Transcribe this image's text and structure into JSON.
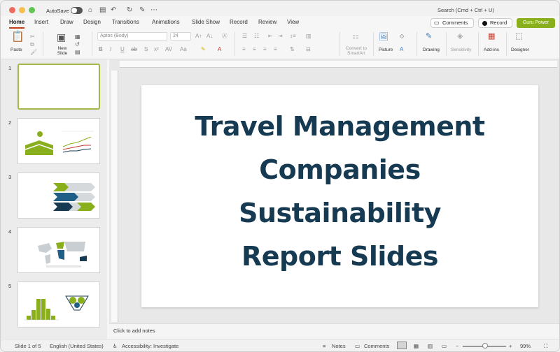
{
  "titlebar": {
    "autosave_label": "AutoSave",
    "search_placeholder": "Search (Cmd + Ctrl + U)"
  },
  "ribbon_tabs": [
    "Home",
    "Insert",
    "Draw",
    "Design",
    "Transitions",
    "Animations",
    "Slide Show",
    "Record",
    "Review",
    "View"
  ],
  "ribbon_buttons": {
    "comments": "Comments",
    "record": "Record",
    "guru_power": "Guru Power"
  },
  "ribbon": {
    "paste": "Paste",
    "new_slide": "New Slide",
    "font_name": "Aptos (Body)",
    "font_size": "24",
    "convert_smartart": "Convert to SmartArt",
    "picture": "Picture",
    "drawing": "Drawing",
    "sensitivity": "Sensitivity",
    "addins": "Add-ins",
    "designer": "Designer"
  },
  "thumbnails": [
    {
      "number": "1"
    },
    {
      "number": "2"
    },
    {
      "number": "3"
    },
    {
      "number": "4"
    },
    {
      "number": "5"
    }
  ],
  "slide": {
    "title_lines": [
      "Travel Management",
      "Companies",
      "Sustainability",
      "Report Slides"
    ],
    "title_color": "#163a52"
  },
  "notes_placeholder": "Click to add notes",
  "status": {
    "slide_counter": "Slide 1 of 5",
    "language": "English (United States)",
    "accessibility": "Accessibility: Investigate",
    "notes": "Notes",
    "comments": "Comments",
    "zoom": "99%"
  },
  "colors": {
    "accent_green": "#8aaf1c",
    "dark_blue": "#163a52",
    "tab_underline": "#c43e1c"
  }
}
